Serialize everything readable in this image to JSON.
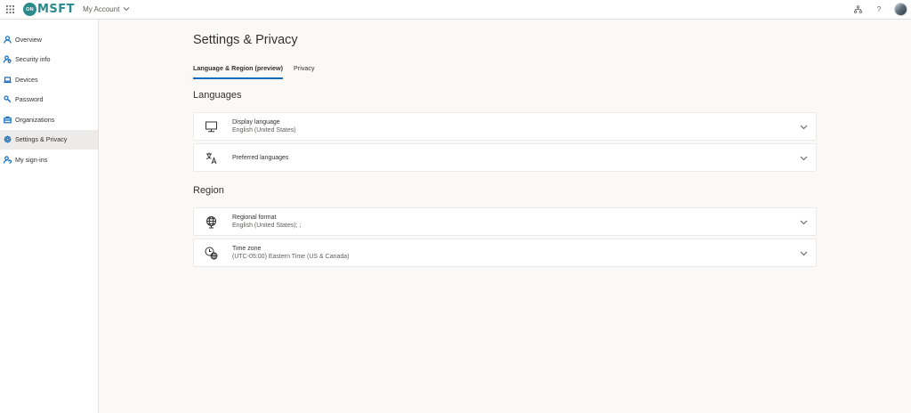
{
  "topbar": {
    "logo_badge": "ON",
    "logo_text": "MSFT",
    "account_label": "My Account",
    "icons": [
      "waffle-icon",
      "chevron-down-icon",
      "org-chart-icon",
      "help-icon",
      "avatar"
    ],
    "help_glyph": "?"
  },
  "sidebar": {
    "items": [
      {
        "label": "Overview",
        "icon": "person-icon"
      },
      {
        "label": "Security info",
        "icon": "security-info-icon"
      },
      {
        "label": "Devices",
        "icon": "laptop-icon"
      },
      {
        "label": "Password",
        "icon": "key-icon"
      },
      {
        "label": "Organizations",
        "icon": "briefcase-icon"
      },
      {
        "label": "Settings & Privacy",
        "icon": "gear-icon",
        "active": true
      },
      {
        "label": "My sign-ins",
        "icon": "person-sync-icon"
      }
    ]
  },
  "main": {
    "title": "Settings & Privacy",
    "tabs": [
      {
        "label": "Language & Region (preview)",
        "active": true
      },
      {
        "label": "Privacy",
        "active": false
      }
    ],
    "languages": {
      "title": "Languages",
      "cards": [
        {
          "title": "Display language",
          "subtitle": "English (United States)",
          "icon": "monitor-icon"
        },
        {
          "title": "Preferred languages",
          "subtitle": "",
          "icon": "language-icon"
        }
      ]
    },
    "region": {
      "title": "Region",
      "cards": [
        {
          "title": "Regional format",
          "subtitle": "English (United States); ;",
          "icon": "globe-icon"
        },
        {
          "title": "Time zone",
          "subtitle": "(UTC-05:00) Eastern Time (US & Canada)",
          "icon": "clock-globe-icon"
        }
      ]
    }
  },
  "colors": {
    "accent": "#0f6cbd",
    "brand": "#2a8a8c",
    "background": "#faf9f8"
  }
}
